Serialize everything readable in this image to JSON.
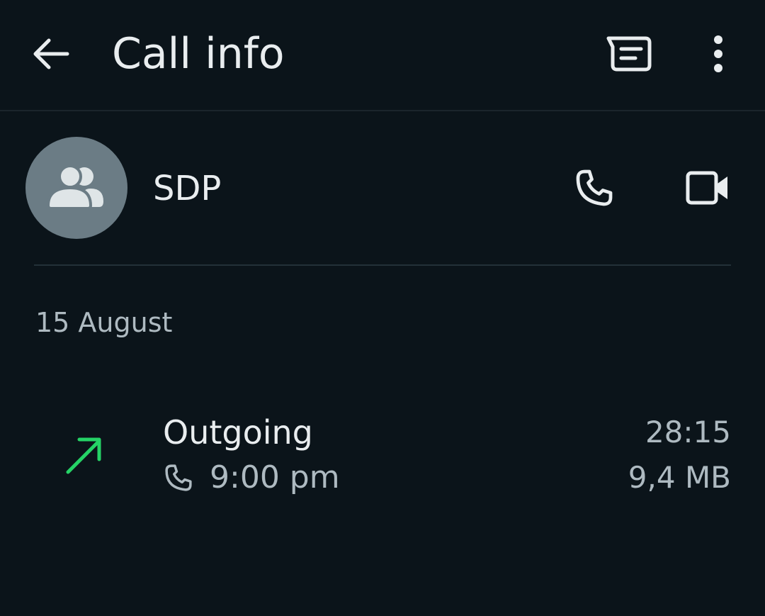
{
  "header": {
    "title": "Call info",
    "icons": {
      "back": "arrow-back-icon",
      "message": "message-icon",
      "menu": "more-vertical-icon"
    }
  },
  "contact": {
    "name": "SDP",
    "avatar_icon": "group-icon",
    "actions": {
      "voice_call": "phone-icon",
      "video_call": "video-camera-icon"
    }
  },
  "call_log": {
    "date": "15 August",
    "entries": [
      {
        "type": "Outgoing",
        "direction_icon": "outgoing-arrow-icon",
        "media_icon": "phone-icon",
        "time": "9:00 pm",
        "duration": "28:15",
        "data_used": "9,4 MB"
      }
    ]
  },
  "colors": {
    "background": "#0b141a",
    "text_primary": "#e9edef",
    "text_secondary": "#aebac1",
    "avatar_bg": "#6b7c85",
    "outgoing_accent": "#25d366"
  }
}
